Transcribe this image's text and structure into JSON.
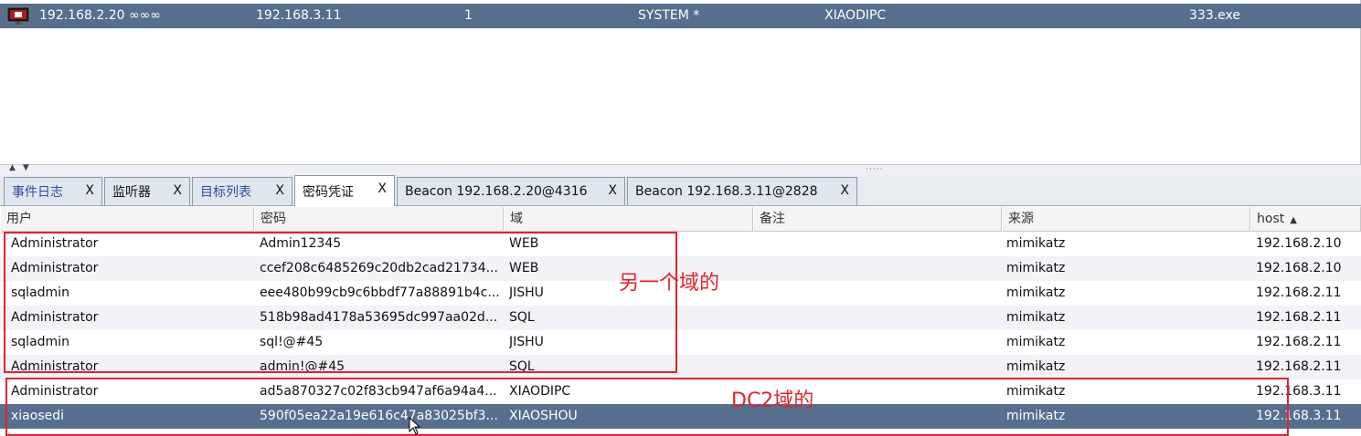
{
  "sessions": [
    {
      "external": "192.168.2.20 ∞∞∞",
      "internal": "192.168.3.11",
      "listener": "1",
      "user": "SYSTEM *",
      "computer": "XIAODIPC",
      "process": "333.exe"
    }
  ],
  "tabs": [
    {
      "label": "事件日志",
      "close": "X"
    },
    {
      "label": "监听器",
      "close": "X"
    },
    {
      "label": "目标列表",
      "close": "X"
    },
    {
      "label": "密码凭证",
      "close": "X"
    },
    {
      "label": "Beacon 192.168.2.20@4316",
      "close": "X"
    },
    {
      "label": "Beacon 192.168.3.11@2828",
      "close": "X"
    }
  ],
  "credentials": {
    "columns": [
      "用户",
      "密码",
      "域",
      "备注",
      "来源",
      "host"
    ],
    "rows": [
      [
        "Administrator",
        "Admin12345",
        "WEB",
        "",
        "mimikatz",
        "192.168.2.10"
      ],
      [
        "Administrator",
        "ccef208c6485269c20db2cad21734...",
        "WEB",
        "",
        "mimikatz",
        "192.168.2.10"
      ],
      [
        "sqladmin",
        "eee480b99cb9c6bbdf77a88891b4c...",
        "JISHU",
        "",
        "mimikatz",
        "192.168.2.11"
      ],
      [
        "Administrator",
        "518b98ad4178a53695dc997aa02d...",
        "SQL",
        "",
        "mimikatz",
        "192.168.2.11"
      ],
      [
        "sqladmin",
        "sql!@#45",
        "JISHU",
        "",
        "mimikatz",
        "192.168.2.11"
      ],
      [
        "Administrator",
        "admin!@#45",
        "SQL",
        "",
        "mimikatz",
        "192.168.2.11"
      ],
      [
        "Administrator",
        "ad5a870327c02f83cb947af6a94a4...",
        "XIAODIPC",
        "",
        "mimikatz",
        "192.168.3.11"
      ],
      [
        "xiaosedi",
        "590f05ea22a19e616c47a83025bf3...",
        "XIAOSHOU",
        "",
        "mimikatz",
        "192.168.3.11"
      ]
    ]
  },
  "annotations": {
    "other_domain": "另一个域的",
    "dc2_domain": "DC2域的"
  },
  "colors": {
    "selection": "#566f8f",
    "annotation": "#e5222b",
    "tab_label": "#2b4f9c"
  }
}
